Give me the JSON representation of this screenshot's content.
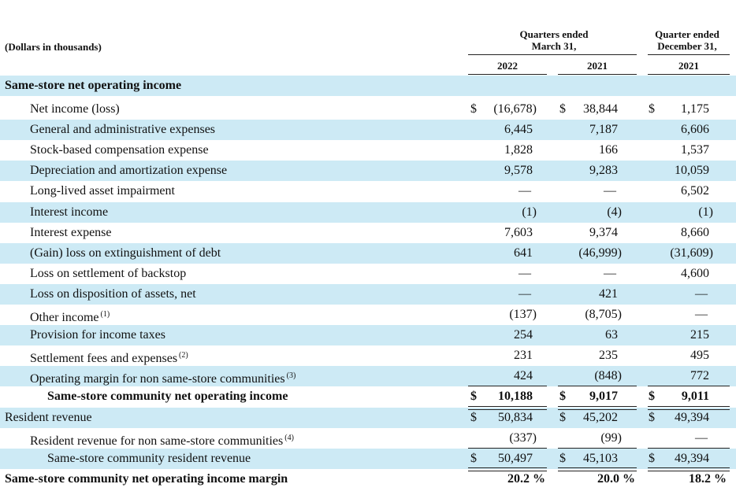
{
  "header": {
    "units": "(Dollars in thousands)",
    "group1_line1": "Quarters ended",
    "group1_line2": "March 31,",
    "group2_line1": "Quarter ended",
    "group2_line2": "December 31,",
    "col1_year": "2022",
    "col2_year": "2021",
    "col3_year": "2021"
  },
  "section_title": "Same-store net operating income",
  "rows": [
    {
      "label": "Net income (loss)",
      "c1": "(16,678)",
      "c2": "38,844",
      "c3": "1,175"
    },
    {
      "label": "General and administrative expenses",
      "c1": "6,445",
      "c2": "7,187",
      "c3": "6,606"
    },
    {
      "label": "Stock-based compensation expense",
      "c1": "1,828",
      "c2": "166",
      "c3": "1,537"
    },
    {
      "label": "Depreciation and amortization expense",
      "c1": "9,578",
      "c2": "9,283",
      "c3": "10,059"
    },
    {
      "label": "Long-lived asset impairment",
      "c1": "—",
      "c2": "—",
      "c3": "6,502"
    },
    {
      "label": "Interest income",
      "c1": "(1)",
      "c2": "(4)",
      "c3": "(1)"
    },
    {
      "label": "Interest expense",
      "c1": "7,603",
      "c2": "9,374",
      "c3": "8,660"
    },
    {
      "label": "(Gain) loss on extinguishment of debt",
      "c1": "641",
      "c2": "(46,999)",
      "c3": "(31,609)"
    },
    {
      "label": "Loss on settlement of backstop",
      "c1": "—",
      "c2": "—",
      "c3": "4,600"
    },
    {
      "label": "Loss on disposition of assets, net",
      "c1": "—",
      "c2": "421",
      "c3": "—"
    },
    {
      "label": "Other income",
      "note": "(1)",
      "c1": "(137)",
      "c2": "(8,705)",
      "c3": "—"
    },
    {
      "label": "Provision for income taxes",
      "c1": "254",
      "c2": "63",
      "c3": "215"
    },
    {
      "label": "Settlement fees and expenses",
      "note": "(2)",
      "c1": "231",
      "c2": "235",
      "c3": "495"
    },
    {
      "label": "Operating margin for non same-store communities",
      "note": "(3)",
      "c1": "424",
      "c2": "(848)",
      "c3": "772"
    },
    {
      "label": "Same-store community net operating income",
      "c1": "10,188",
      "c2": "9,017",
      "c3": "9,011"
    },
    {
      "label": "Resident revenue",
      "c1": "50,834",
      "c2": "45,202",
      "c3": "49,394"
    },
    {
      "label": "Resident revenue for non same-store communities",
      "note": "(4)",
      "c1": "(337)",
      "c2": "(99)",
      "c3": "—"
    },
    {
      "label": "Same-store community resident revenue",
      "c1": "50,497",
      "c2": "45,103",
      "c3": "49,394"
    },
    {
      "label": "Same-store community net operating income margin",
      "c1": "20.2 %",
      "c2": "20.0 %",
      "c3": "18.2 %"
    }
  ],
  "currency_symbol": "$"
}
